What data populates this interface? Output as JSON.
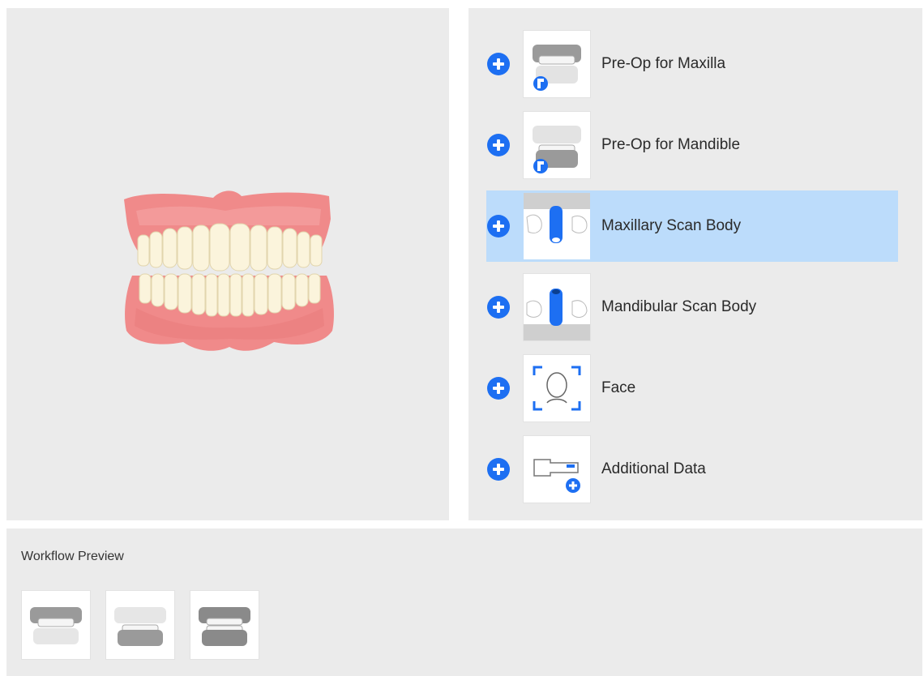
{
  "colors": {
    "accent": "#1d6ff2",
    "selected_row": "#bcdcfb",
    "panel_bg": "#ebebeb"
  },
  "model_preview": {
    "icon": "full-denture-model"
  },
  "scan_items": [
    {
      "label": "Pre-Op for Maxilla",
      "icon": "pre-op-maxilla-icon",
      "selected": false
    },
    {
      "label": "Pre-Op for Mandible",
      "icon": "pre-op-mandible-icon",
      "selected": false
    },
    {
      "label": "Maxillary Scan Body",
      "icon": "maxillary-scan-body-icon",
      "selected": true
    },
    {
      "label": "Mandibular Scan Body",
      "icon": "mandibular-scan-body-icon",
      "selected": false
    },
    {
      "label": "Face",
      "icon": "face-scan-icon",
      "selected": false
    },
    {
      "label": "Additional Data",
      "icon": "additional-data-icon",
      "selected": false
    }
  ],
  "workflow_preview": {
    "title": "Workflow Preview",
    "thumbs": [
      "maxilla-step-icon",
      "mandible-step-icon",
      "occlusion-step-icon"
    ]
  }
}
